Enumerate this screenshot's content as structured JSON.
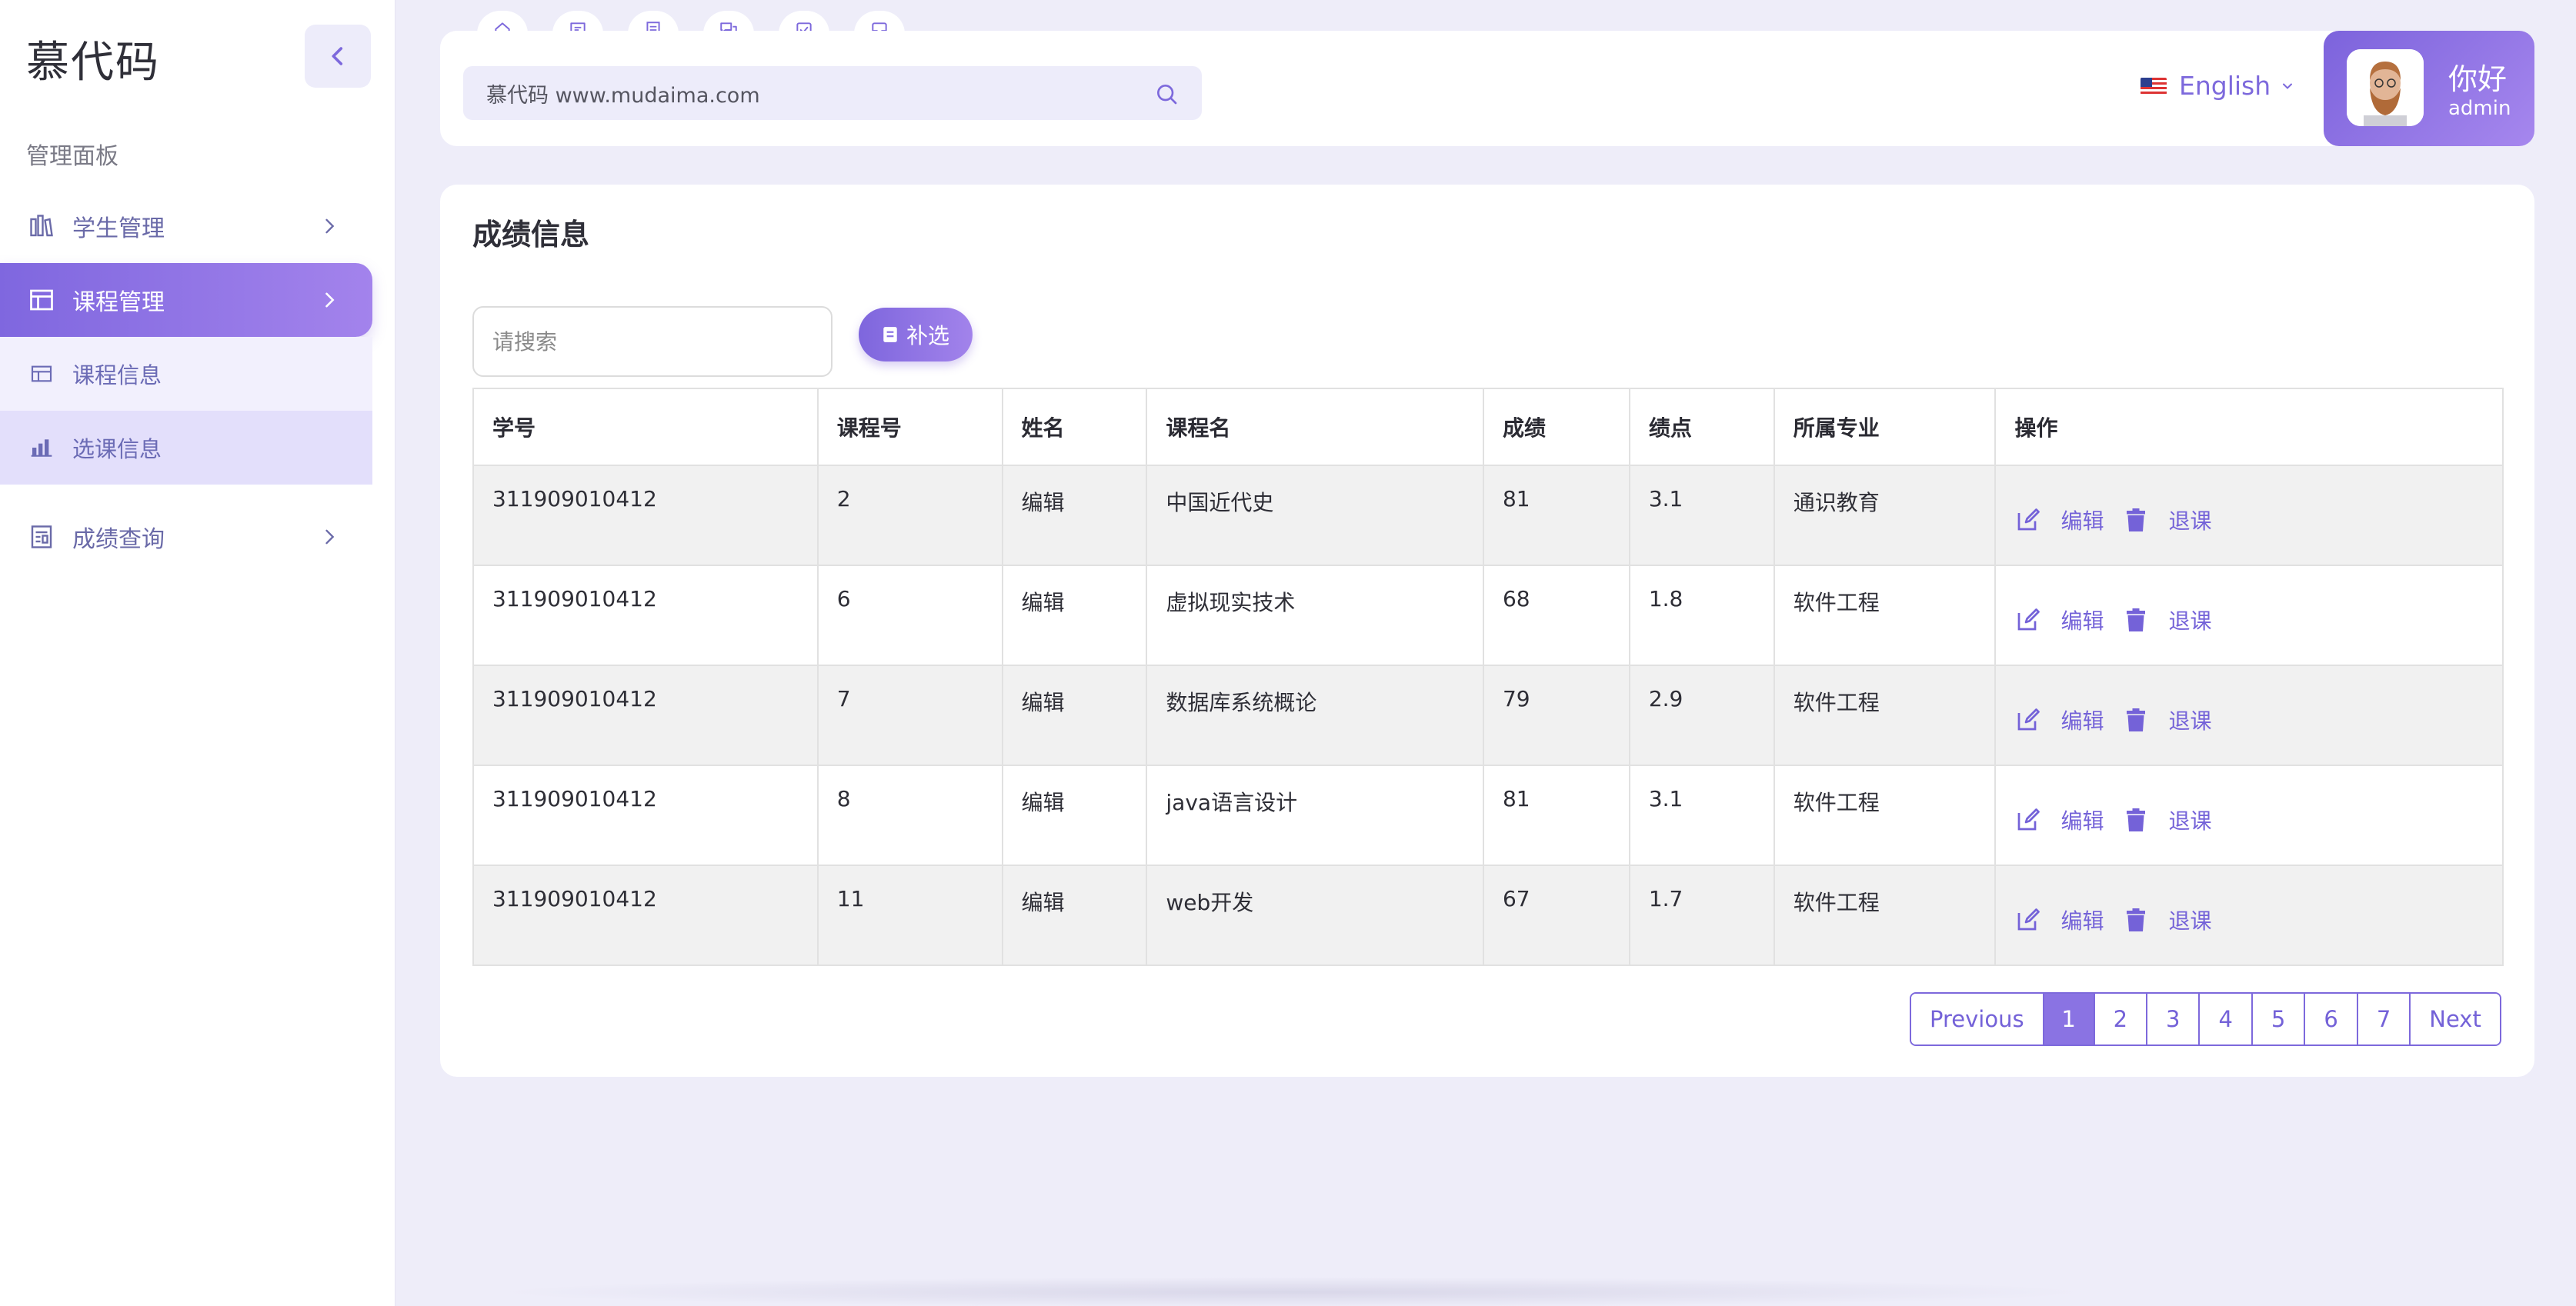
{
  "brand": "慕代码",
  "sidebar": {
    "section_title": "管理面板",
    "items": [
      {
        "label": "学生管理",
        "icon": "students-icon"
      },
      {
        "label": "课程管理",
        "icon": "table-icon"
      },
      {
        "label": "成绩查询",
        "icon": "report-icon"
      }
    ],
    "subitems": [
      {
        "label": "课程信息",
        "icon": "table-icon"
      },
      {
        "label": "选课信息",
        "icon": "bar-chart-icon"
      }
    ],
    "active_item": "课程管理",
    "selected_subitem": "选课信息"
  },
  "header": {
    "search_value": "慕代码 www.mudaima.com",
    "quick_tabs": [
      "home-icon",
      "message-icon",
      "document-icon",
      "chat-icon",
      "checkbox-icon",
      "inbox-icon"
    ],
    "language": "English",
    "greeting": "你好",
    "username": "admin"
  },
  "main": {
    "title": "成绩信息",
    "search_placeholder": "请搜索",
    "filter_button": "补选",
    "columns": [
      "学号",
      "课程号",
      "姓名",
      "课程名",
      "成绩",
      "绩点",
      "所属专业",
      "操作"
    ],
    "rows": [
      {
        "student_id": "311909010412",
        "course_id": "2",
        "name": "编辑",
        "course_name": "中国近代史",
        "score": "81",
        "gpa": "3.1",
        "major": "通识教育"
      },
      {
        "student_id": "311909010412",
        "course_id": "6",
        "name": "编辑",
        "course_name": "虚拟现实技术",
        "score": "68",
        "gpa": "1.8",
        "major": "软件工程"
      },
      {
        "student_id": "311909010412",
        "course_id": "7",
        "name": "编辑",
        "course_name": "数据库系统概论",
        "score": "79",
        "gpa": "2.9",
        "major": "软件工程"
      },
      {
        "student_id": "311909010412",
        "course_id": "8",
        "name": "编辑",
        "course_name": "java语言设计",
        "score": "81",
        "gpa": "3.1",
        "major": "软件工程"
      },
      {
        "student_id": "311909010412",
        "course_id": "11",
        "name": "编辑",
        "course_name": "web开发",
        "score": "67",
        "gpa": "1.7",
        "major": "软件工程"
      }
    ],
    "row_actions": {
      "edit": "编辑",
      "drop": "退课"
    },
    "pagination": {
      "previous": "Previous",
      "pages": [
        "1",
        "2",
        "3",
        "4",
        "5",
        "6",
        "7"
      ],
      "current": "1",
      "next": "Next"
    }
  },
  "colors": {
    "accent": "#7e66dd",
    "accent_light": "#a283eb",
    "background": "#eeedf9"
  }
}
